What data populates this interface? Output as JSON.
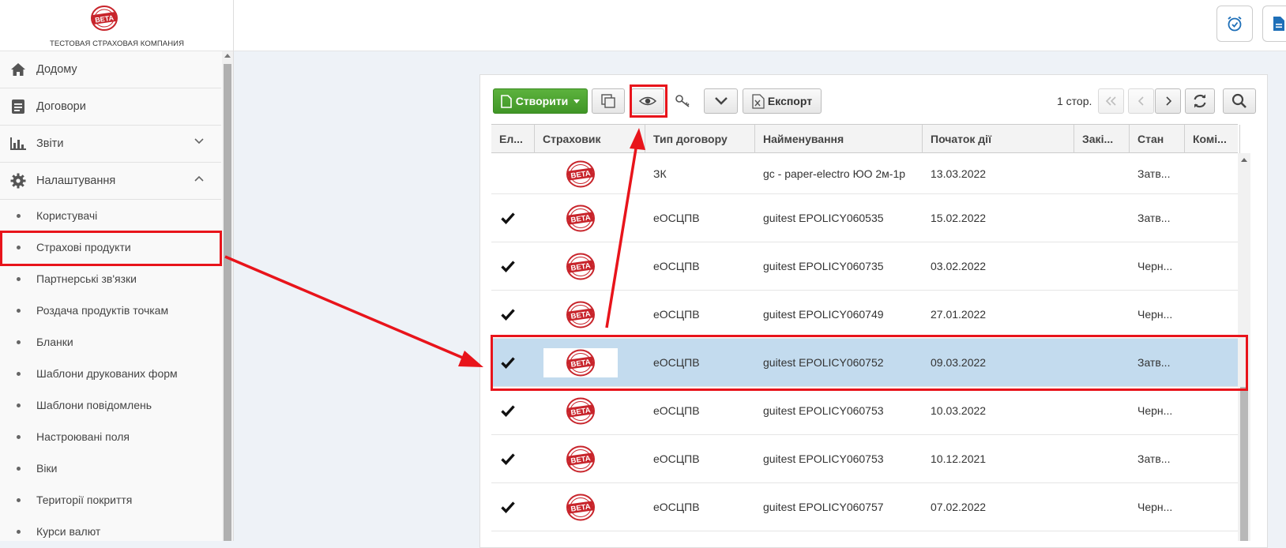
{
  "company": {
    "name": "ТЕСТОВАЯ СТРАХОВАЯ КОМПАНИЯ",
    "logo_text": "BETA"
  },
  "sidebar": {
    "items": [
      {
        "label": "Додому",
        "icon": "home-icon"
      },
      {
        "label": "Договори",
        "icon": "document-icon"
      },
      {
        "label": "Звіти",
        "icon": "bar-chart-icon"
      },
      {
        "label": "Налаштування",
        "icon": "gear-icon"
      }
    ],
    "subitems": [
      "Користувачі",
      "Страхові продукти",
      "Партнерські зв'язки",
      "Роздача продуктів точкам",
      "Бланки",
      "Шаблони друкованих форм",
      "Шаблони повідомлень",
      "Настроювані поля",
      "Віки",
      "Території покриття",
      "Курси валют"
    ]
  },
  "toolbar": {
    "create_label": "Створити",
    "export_label": "Експорт",
    "pager_label": "1 стор."
  },
  "table": {
    "columns": [
      "Ел...",
      "Страховик",
      "Тип договору",
      "Найменування",
      "Початок дії",
      "Закі...",
      "Стан",
      "Комі..."
    ],
    "rows": [
      {
        "checked": false,
        "type": "ЗК",
        "name": "gc - paper-electro ЮО 2м-1р",
        "start": "13.03.2022",
        "state": "Затв...",
        "selected": false
      },
      {
        "checked": true,
        "type": "еОСЦПВ",
        "name": "guitest EPOLICY060535",
        "start": "15.02.2022",
        "state": "Затв...",
        "selected": false
      },
      {
        "checked": true,
        "type": "еОСЦПВ",
        "name": "guitest EPOLICY060735",
        "start": "03.02.2022",
        "state": "Черн...",
        "selected": false
      },
      {
        "checked": true,
        "type": "еОСЦПВ",
        "name": "guitest EPOLICY060749",
        "start": "27.01.2022",
        "state": "Черн...",
        "selected": false
      },
      {
        "checked": true,
        "type": "еОСЦПВ",
        "name": "guitest EPOLICY060752",
        "start": "09.03.2022",
        "state": "Затв...",
        "selected": true
      },
      {
        "checked": true,
        "type": "еОСЦПВ",
        "name": "guitest EPOLICY060753",
        "start": "10.03.2022",
        "state": "Черн...",
        "selected": false
      },
      {
        "checked": true,
        "type": "еОСЦПВ",
        "name": "guitest EPOLICY060753",
        "start": "10.12.2021",
        "state": "Затв...",
        "selected": false
      },
      {
        "checked": true,
        "type": "еОСЦПВ",
        "name": "guitest EPOLICY060757",
        "start": "07.02.2022",
        "state": "Черн...",
        "selected": false
      }
    ]
  },
  "colors": {
    "annotation_red": "#e8141b",
    "create_green": "#4ea631",
    "selected_row": "#c3dbee",
    "brand_stamp": "#c8242b"
  }
}
